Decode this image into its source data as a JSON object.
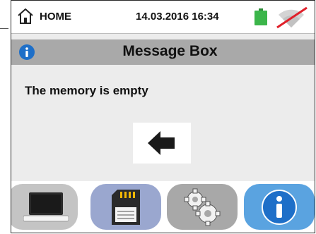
{
  "header": {
    "home_label": "HOME",
    "datetime": "14.03.2016  16:34",
    "icons": [
      "home-icon",
      "battery-icon",
      "no-signal-icon"
    ],
    "battery_color": "#3bb54a",
    "no_signal_color": "#e0202a"
  },
  "dialog": {
    "title": "Message Box",
    "title_bar_color": "#a9a9a9",
    "info_color": "#1e6fc8",
    "message": "The memory is empty",
    "back_icon": "arrow-left-icon"
  },
  "toolbar": {
    "buttons": [
      {
        "icon": "laptop-icon",
        "color": "#c4c4c4"
      },
      {
        "icon": "sd-card-icon",
        "color": "#9aa7cf"
      },
      {
        "icon": "gears-icon",
        "color": "#a8a8a8"
      },
      {
        "icon": "info-icon",
        "color": "#5aa3e0"
      }
    ]
  }
}
